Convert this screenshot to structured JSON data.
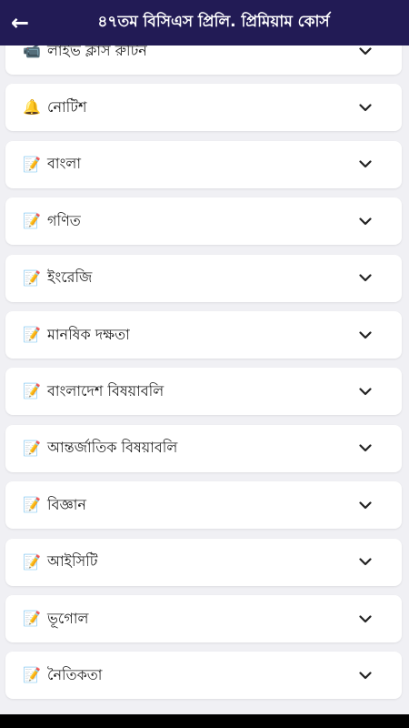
{
  "appbar": {
    "title": "৪৭তম বিসিএস প্রিলি. প্রিমিয়াম কোর্স",
    "back_icon": "arrow-left-icon"
  },
  "items": [
    {
      "icon": "📹",
      "label": "লাইভ ক্লাস রুটিন"
    },
    {
      "icon": "🔔",
      "label": "নোটিশ"
    },
    {
      "icon": "📝",
      "label": "বাংলা"
    },
    {
      "icon": "📝",
      "label": "গণিত"
    },
    {
      "icon": "📝",
      "label": "ইংরেজি"
    },
    {
      "icon": "📝",
      "label": "মানষিক দক্ষতা"
    },
    {
      "icon": "📝",
      "label": "বাংলাদেশ বিষয়াবলি"
    },
    {
      "icon": "📝",
      "label": "আন্তর্জাতিক বিষয়াবলি"
    },
    {
      "icon": "📝",
      "label": "বিজ্ঞান"
    },
    {
      "icon": "📝",
      "label": "আইসিটি"
    },
    {
      "icon": "📝",
      "label": "ভূগোল"
    },
    {
      "icon": "📝",
      "label": "নৈতিকতা"
    }
  ]
}
